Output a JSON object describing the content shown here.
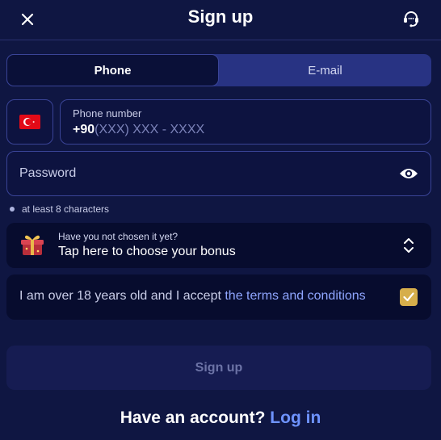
{
  "header": {
    "title": "Sign up",
    "close_icon": "close-icon",
    "support_icon": "support-agent-icon"
  },
  "tabs": [
    {
      "label": "Phone",
      "active": true
    },
    {
      "label": "E-mail",
      "active": false
    }
  ],
  "phone": {
    "country_flag": "flag-turkey-icon",
    "label": "Phone number",
    "prefix": "+90",
    "placeholder": "(XXX) XXX - XXXX"
  },
  "password": {
    "placeholder": "Password",
    "toggle_icon": "eye-icon",
    "hint": "at least 8 characters"
  },
  "bonus": {
    "question": "Have you not chosen it yet?",
    "action": "Tap here to choose your bonus",
    "icon": "gift-icon"
  },
  "terms": {
    "text": "I am over 18 years old and I accept ",
    "link": "the terms and conditions",
    "checked": true
  },
  "submit": {
    "label": "Sign up"
  },
  "login": {
    "prompt": "Have an account?",
    "link": "Log in"
  },
  "colors": {
    "background": "#0f1642",
    "field_border": "#3a4497",
    "tab_track": "#283383",
    "link": "#8fa6ff",
    "checkbox": "#d6ae4b",
    "disabled_button": "#161c52"
  }
}
